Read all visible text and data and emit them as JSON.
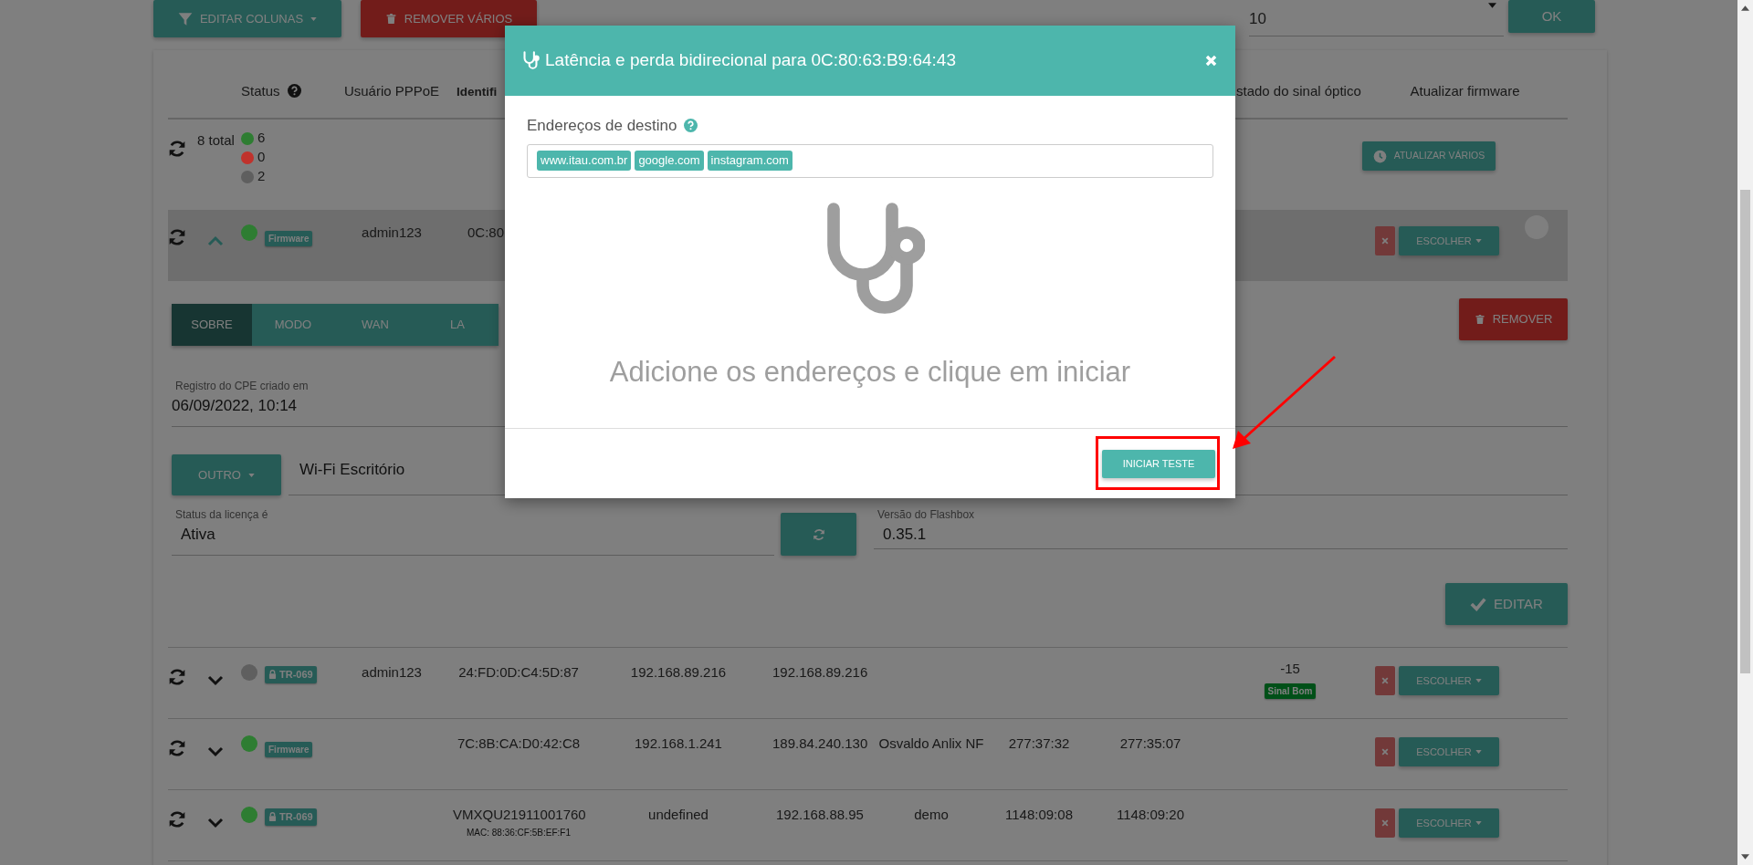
{
  "toolbar": {
    "edit_columns": "EDITAR COLUNAS",
    "remove_many": "REMOVER VÁRIOS",
    "per_page": "10",
    "ok": "OK"
  },
  "table": {
    "status_header": "Status",
    "pppoe_header": "Usuário PPPoE",
    "column_3_header": "Identifi",
    "optical_header": "stado do sinal óptico",
    "firmware_header": "Atualizar firmware",
    "summary": {
      "total": "8 total",
      "counts": [
        {
          "color": "#2e7d32",
          "count": "6"
        },
        {
          "color": "#c0322c",
          "count": "0"
        },
        {
          "color": "#5f5f5f",
          "count": "2"
        }
      ],
      "update_button": "ATUALIZAR VÁRIOS"
    },
    "rows": [
      {
        "expanded": true,
        "color": "#2e7d32",
        "badge": "Firmware",
        "locked": false,
        "user": "admin123",
        "id": "0C:80:",
        "choose": "ESCOLHER",
        "selection_circle": true
      },
      {
        "expanded": false,
        "color": "#5f5f5f",
        "badge": "TR-069",
        "locked": true,
        "user": "admin123",
        "id": "24:FD:0D:C4:5D:87",
        "ip_1": "192.168.89.216",
        "ip_2": "192.168.89.216",
        "signal": "-15",
        "signal_badge": "Sinal Bom",
        "choose": "ESCOLHER",
        "selection_circle": false
      },
      {
        "expanded": false,
        "color": "#2e7d32",
        "badge": "Firmware",
        "locked": false,
        "id": "7C:8B:CA:D0:42:C8",
        "ip_1": "192.168.1.241",
        "ip_2": "189.84.240.130",
        "name": "Osvaldo Anlix NF",
        "time_1": "277:37:32",
        "time_2": "277:35:07",
        "choose": "ESCOLHER",
        "selection_circle": false
      },
      {
        "expanded": false,
        "color": "#2e7d32",
        "badge": "TR-069",
        "locked": true,
        "id": "VMXQU21911001760",
        "mac": "MAC: 88:36:CF:5B:EF:F1",
        "ip_1": "undefined",
        "ip_2": "192.168.88.95",
        "name": "demo",
        "time_1": "1148:09:08",
        "time_2": "1148:09:20",
        "choose": "ESCOLHER",
        "selection_circle": false
      }
    ]
  },
  "details": {
    "tabs": [
      {
        "label": "SOBRE",
        "selected": true
      },
      {
        "label": "MODO",
        "selected": false
      },
      {
        "label": "WAN",
        "selected": false
      },
      {
        "label": "LA",
        "selected": false
      }
    ],
    "remove": "REMOVER",
    "created_label": "Registro do CPE criado em",
    "created_value": "06/09/2022, 10:14",
    "mode_button": "OUTRO",
    "wifi_value": "Wi-Fi Escritório",
    "license_label": "Status da licença é",
    "license_value": "Ativa",
    "flashbox_label": "Versão do Flashbox",
    "flashbox_value": "0.35.1",
    "edit": "EDITAR"
  },
  "modal": {
    "title": "Latência e perda bidirecional para 0C:80:63:B9:64:43",
    "destinations_label": "Endereços de destino",
    "tags": [
      "www.itau.com.br",
      "google.com",
      "instagram.com"
    ],
    "empty_message": "Adicione os endereços e clique em iniciar",
    "start_button": "INICIAR TESTE"
  }
}
